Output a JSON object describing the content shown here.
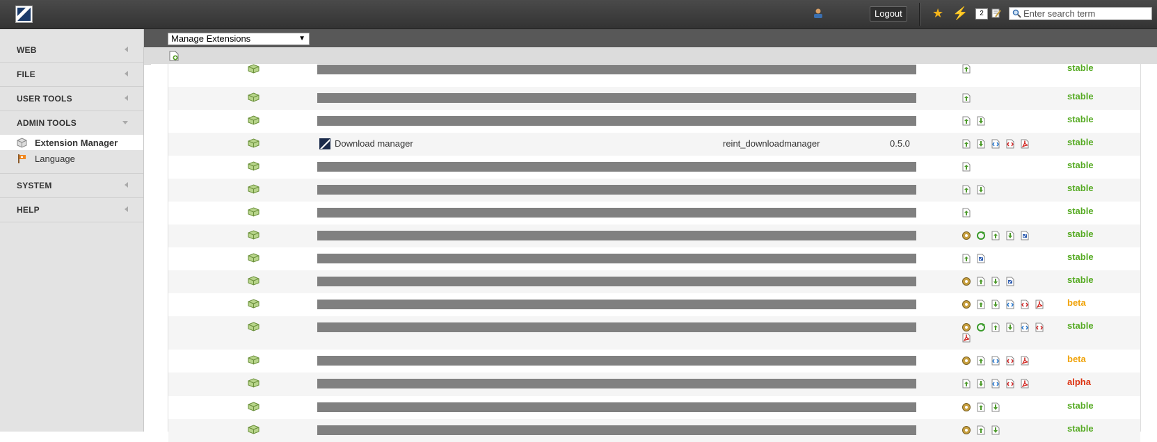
{
  "topbar": {
    "logout_label": "Logout",
    "bookmark_icon": "star-icon",
    "shortcut_icon": "flash-icon",
    "notes_count": "2",
    "search_placeholder": "Enter search term"
  },
  "sidebar": {
    "sections": [
      {
        "label": "WEB",
        "expanded": false
      },
      {
        "label": "FILE",
        "expanded": false
      },
      {
        "label": "USER TOOLS",
        "expanded": false
      },
      {
        "label": "ADMIN TOOLS",
        "expanded": true
      },
      {
        "label": "SYSTEM",
        "expanded": false
      },
      {
        "label": "HELP",
        "expanded": false
      }
    ],
    "admin_items": [
      {
        "label": "Extension Manager",
        "icon": "extension-manager-icon",
        "active": true
      },
      {
        "label": "Language",
        "icon": "language-flag-icon",
        "active": false
      }
    ]
  },
  "module": {
    "menu_selected": "Manage Extensions",
    "new_icon": "new-document-icon"
  },
  "colors": {
    "stable": "#55aa22",
    "beta": "#f0a30a",
    "alpha": "#dd3311",
    "topbar": "#3c3c3c",
    "docheader": "#585858"
  },
  "extensions": [
    {
      "redacted": true,
      "actions": [
        "import"
      ],
      "state": "stable"
    },
    {
      "redacted": true,
      "actions": [
        "import"
      ],
      "state": "stable"
    },
    {
      "redacted": true,
      "actions": [
        "import",
        "download"
      ],
      "state": "stable"
    },
    {
      "redacted": false,
      "title": "Download manager",
      "key": "reint_downloadmanager",
      "version": "0.5.0",
      "actions": [
        "import",
        "download",
        "code",
        "code-red",
        "pdf"
      ],
      "state": "stable"
    },
    {
      "redacted": true,
      "actions": [
        "import"
      ],
      "state": "stable"
    },
    {
      "redacted": true,
      "actions": [
        "import",
        "download"
      ],
      "state": "stable"
    },
    {
      "redacted": true,
      "actions": [
        "import"
      ],
      "state": "stable"
    },
    {
      "redacted": true,
      "actions": [
        "configure",
        "update",
        "import",
        "download",
        "doc"
      ],
      "state": "stable"
    },
    {
      "redacted": true,
      "actions": [
        "import",
        "doc"
      ],
      "state": "stable"
    },
    {
      "redacted": true,
      "actions": [
        "configure",
        "import",
        "download",
        "doc"
      ],
      "state": "stable"
    },
    {
      "redacted": true,
      "actions": [
        "configure",
        "import",
        "download",
        "code",
        "code-red",
        "pdf"
      ],
      "state": "beta"
    },
    {
      "redacted": true,
      "actions": [
        "configure",
        "update",
        "import",
        "download",
        "code",
        "code-red",
        "pdf"
      ],
      "state": "stable"
    },
    {
      "redacted": true,
      "actions": [
        "configure",
        "import",
        "code",
        "code-red",
        "pdf"
      ],
      "state": "beta"
    },
    {
      "redacted": true,
      "actions": [
        "import",
        "download",
        "code",
        "code-red",
        "pdf"
      ],
      "state": "alpha"
    },
    {
      "redacted": true,
      "actions": [
        "configure",
        "import",
        "download"
      ],
      "state": "stable"
    },
    {
      "redacted": true,
      "actions": [
        "configure",
        "import",
        "download"
      ],
      "state": "stable"
    }
  ]
}
